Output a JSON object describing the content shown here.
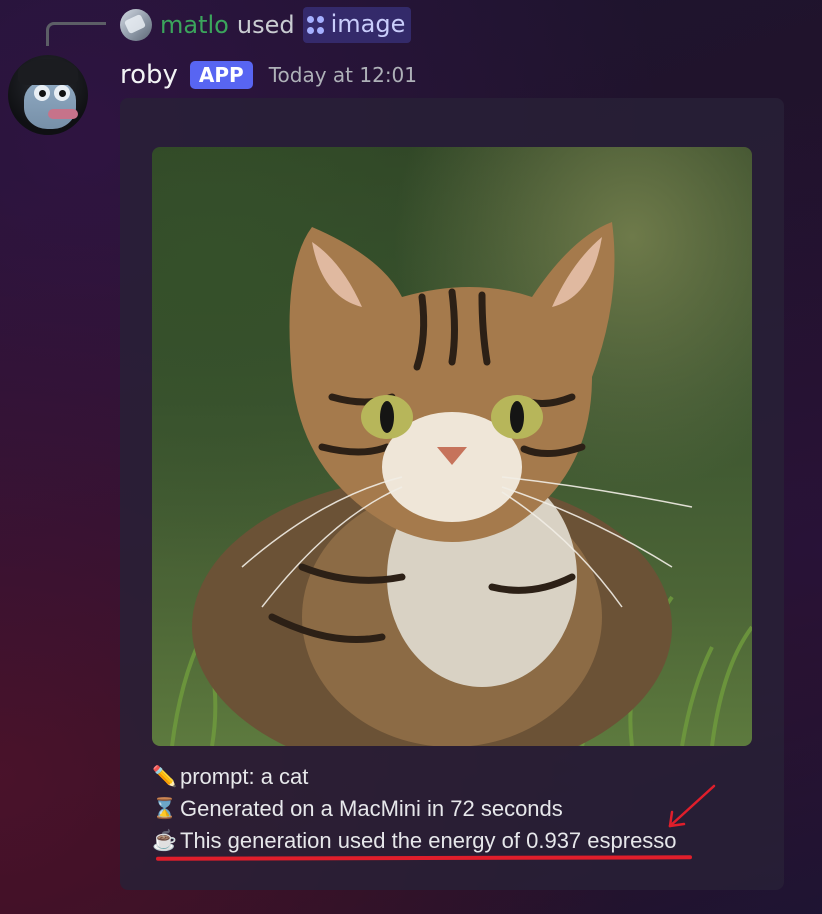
{
  "reply": {
    "username": "matlo",
    "used_text": "used",
    "command_name": "image",
    "command_icon": "slash-command-icon"
  },
  "message": {
    "author": "roby",
    "badge": "APP",
    "timestamp": "Today at 12:01"
  },
  "embed": {
    "image_subject": "cat",
    "lines": [
      {
        "icon": "pencil-icon",
        "emoji": "✏️",
        "text": "prompt: a cat"
      },
      {
        "icon": "hourglass-icon",
        "emoji": "⌛",
        "text": "Generated on a MacMini in 72 seconds"
      },
      {
        "icon": "coffee-icon",
        "emoji": "☕",
        "text": "This generation used the energy of 0.937 espresso"
      }
    ]
  },
  "annotation": {
    "color": "#e01e2b"
  },
  "colors": {
    "reply_user": "#3ba55c",
    "app_badge": "#5865f2",
    "command_pill": "#c9cdfb"
  }
}
